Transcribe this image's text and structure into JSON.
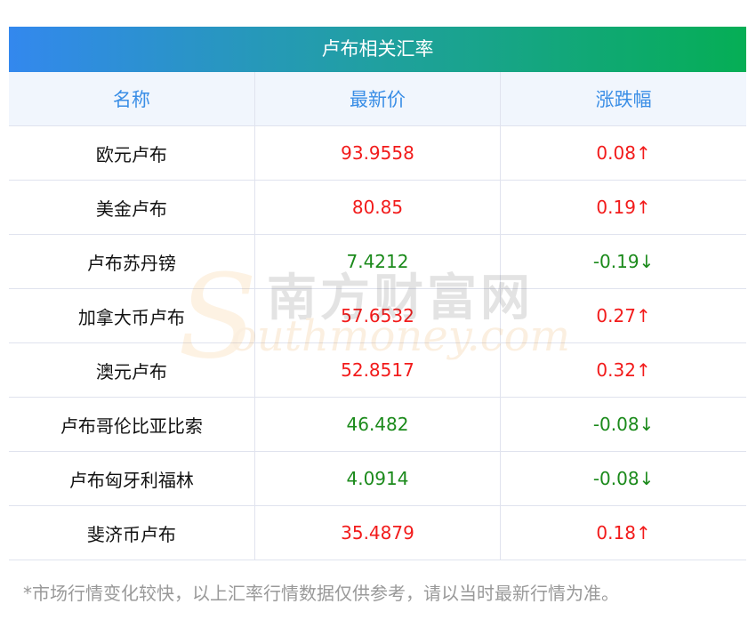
{
  "title": "卢布相关汇率",
  "headers": [
    "名称",
    "最新价",
    "涨跌幅"
  ],
  "rows": [
    {
      "name": "欧元卢布",
      "price": "93.9558",
      "change": "0.08↑",
      "dir": "up"
    },
    {
      "name": "美金卢布",
      "price": "80.85",
      "change": "0.19↑",
      "dir": "up"
    },
    {
      "name": "卢布苏丹镑",
      "price": "7.4212",
      "change": "-0.19↓",
      "dir": "down"
    },
    {
      "name": "加拿大币卢布",
      "price": "57.6532",
      "change": "0.27↑",
      "dir": "up"
    },
    {
      "name": "澳元卢布",
      "price": "52.8517",
      "change": "0.32↑",
      "dir": "up"
    },
    {
      "name": "卢布哥伦比亚比索",
      "price": "46.482",
      "change": "-0.08↓",
      "dir": "down"
    },
    {
      "name": "卢布匈牙利福林",
      "price": "4.0914",
      "change": "-0.08↓",
      "dir": "down"
    },
    {
      "name": "斐济币卢布",
      "price": "35.4879",
      "change": "0.18↑",
      "dir": "up"
    }
  ],
  "footnote": "*市场行情变化较快，以上汇率行情数据仅供参考，请以当时最新行情为准。",
  "watermark": {
    "cn": "南方财富网",
    "en": "outhmoney.com",
    "s": "S"
  },
  "colors": {
    "up": "#f21b1b",
    "down": "#1b8a1b",
    "header_text": "#3a8ee6"
  }
}
